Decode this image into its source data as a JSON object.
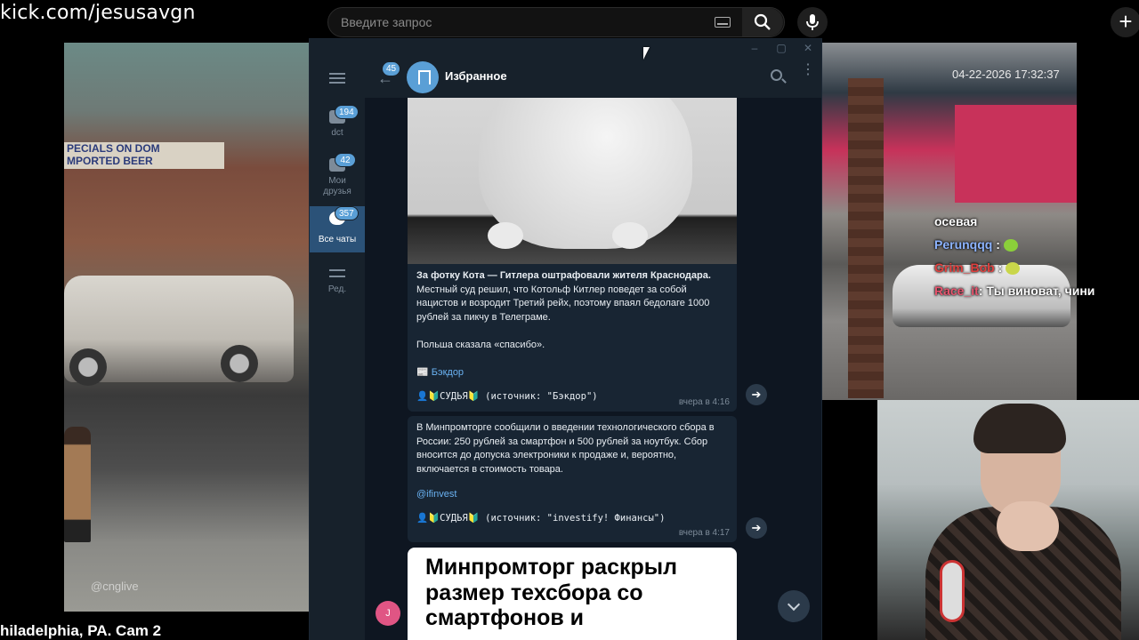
{
  "top": {
    "url": "kick.com/jesusavgn",
    "search_placeholder": "Введите запрос"
  },
  "stream": {
    "cam_timestamp": "04-22-2026 17:32:37",
    "watermark": "@cnglive",
    "caption": "hiladelphia, PA. Cam 2",
    "store_sign": "PECIALS ON DOM\nMPORTED BEER"
  },
  "chat_overlay": [
    {
      "user": "",
      "text": "осевая"
    },
    {
      "user": "Perunqqq",
      "text": ":"
    },
    {
      "user": "Grim_Bob",
      "text": ":"
    },
    {
      "user": "Race_it",
      "text": ": Ты виноват, чини"
    }
  ],
  "telegram": {
    "folders": [
      {
        "label": "dct",
        "badge": "194"
      },
      {
        "label": "Мои друзья",
        "badge": "42"
      },
      {
        "label": "Все чаты",
        "badge": "357"
      },
      {
        "label": "Ред.",
        "badge": ""
      }
    ],
    "back_badge": "45",
    "chat_title": "Избранное",
    "messages": [
      {
        "headline": "За фотку Кота — Гитлера оштрафовали жителя Краснодара.",
        "body": "Местный суд решил, что Котольф Китлер поведет за собой нацистов и возродит Третий рейх, поэтому впаял бедолаге 1000 рублей за пикчу в Телеграме.",
        "extra": "Польша сказала «спасибо».",
        "source_link": "📰 Бэкдор",
        "signature": "👤🔰СУДЬЯ🔰 (источник: \"Бэкдор\")",
        "time": "вчера в 4:16"
      },
      {
        "body": "В Минпромторге сообщили о введении технологического сбора в России: 250 рублей за смартфон и 500 рублей за ноутбук. Сбор вносится до допуска электроники к продаже и, вероятно, включается в стоимость товара.",
        "source_link": "@ifinvest",
        "signature": "👤🔰СУДЬЯ🔰 (источник: \"investify! Финансы\")",
        "time": "вчера в 4:17"
      }
    ],
    "card_text": "Минпромторг раскрыл размер техсбора со смартфонов и",
    "mini_avatar_letter": "J"
  },
  "colors": {
    "tg_bg": "#0e1621",
    "tg_panel": "#17212b",
    "tg_bubble": "#182533",
    "tg_accent": "#5a9fd6",
    "link": "#6ab2f2"
  }
}
